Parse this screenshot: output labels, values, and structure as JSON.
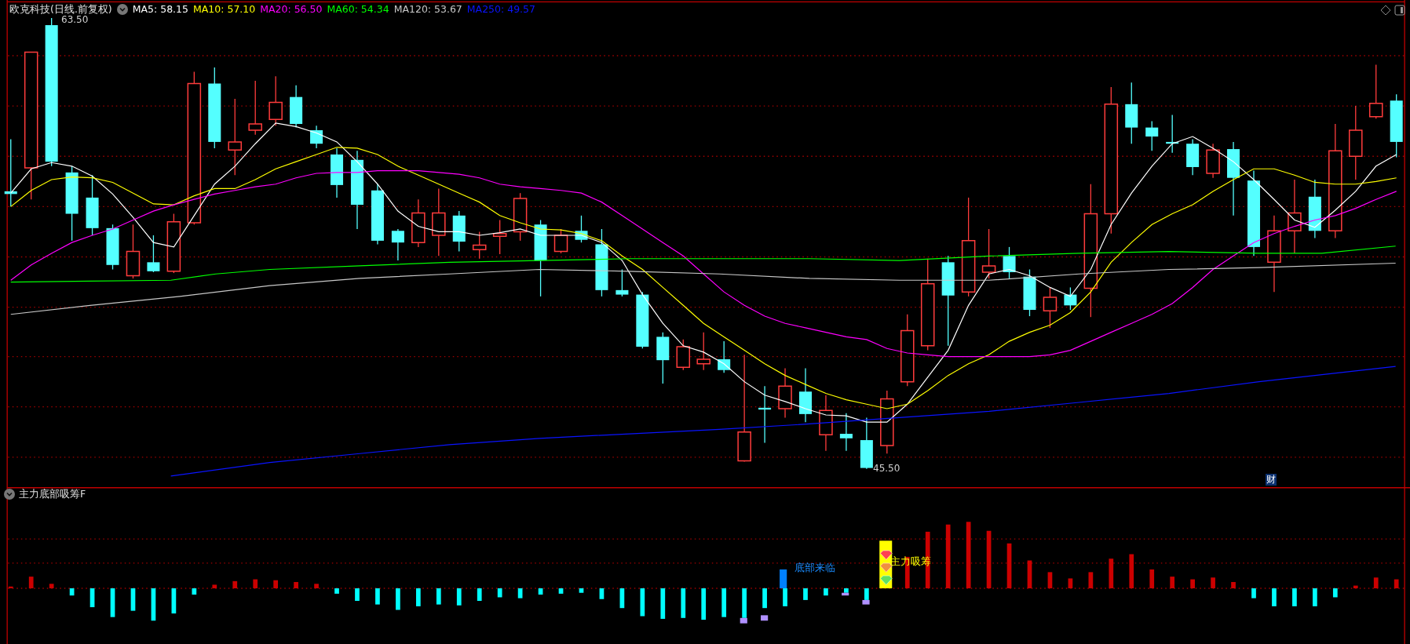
{
  "title": "欧克科技(日线.前复权)",
  "moving_averages": [
    {
      "label": "MA5: 58.15",
      "color": "#ffffff"
    },
    {
      "label": "MA10: 57.10",
      "color": "#ffff00"
    },
    {
      "label": "MA20: 56.50",
      "color": "#ff00ff"
    },
    {
      "label": "MA60: 54.34",
      "color": "#00ff00"
    },
    {
      "label": "MA120: 53.67",
      "color": "#c8c8c8"
    },
    {
      "label": "MA250: 49.57",
      "color": "#0a14ff"
    }
  ],
  "price_labels": [
    {
      "kind": "high",
      "text": "63.50"
    },
    {
      "kind": "low",
      "text": "45.50"
    }
  ],
  "finance_marker": "财",
  "indicator": {
    "title": "主力底部吸筹F",
    "signals": [
      {
        "kind": "bottom",
        "text": "底部来临"
      },
      {
        "kind": "accumulate",
        "text": "主力吸筹"
      }
    ]
  }
}
